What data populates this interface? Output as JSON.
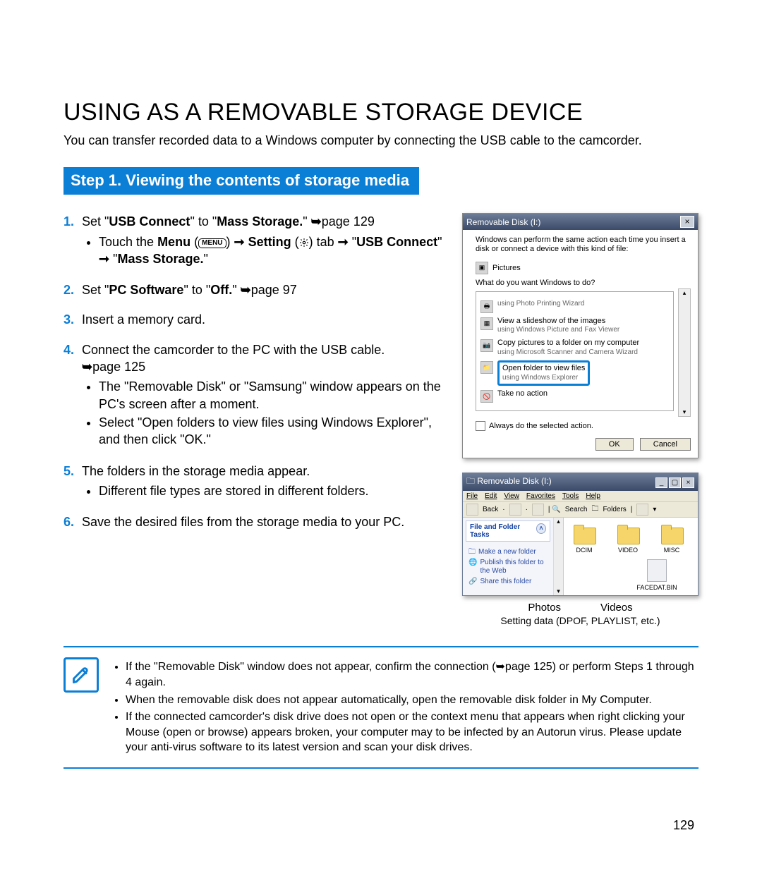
{
  "title": "USING AS A REMOVABLE STORAGE DEVICE",
  "intro": "You can transfer recorded data to a Windows computer by connecting the USB cable to the camcorder.",
  "step_heading": "Step 1. Viewing the contents of storage media",
  "arrow": "➞",
  "parrow": "➥",
  "menu_badge": "MENU",
  "li1": {
    "pre": "Set \"",
    "u": "USB Connect",
    "mid": "\" to \"",
    "m": "Mass Storage.",
    "post": "\" ",
    "page": "page 129"
  },
  "li1b": {
    "pre": "Touch the ",
    "menu": "Menu",
    "setting": "Setting",
    "tab": " tab ",
    "usb": "USB Connect",
    "ms": "Mass Storage."
  },
  "li2": {
    "pre": "Set \"",
    "pc": "PC Software",
    "mid": "\" to \"",
    "off": "Off.",
    "post": "\" ",
    "page": "page 97"
  },
  "li3": "Insert a memory card.",
  "li4": {
    "t": "Connect the camcorder to the PC with the USB cable.",
    "page": "page 125",
    "b1": "The \"Removable Disk\" or \"Samsung\" window appears on the PC's screen after a moment.",
    "b2": "Select \"Open folders to view files using Windows Explorer\", and then click \"OK.\""
  },
  "li5": {
    "t": "The folders in the storage media appear.",
    "b1": "Different file types are stored in different folders."
  },
  "li6": "Save the desired files from the storage media to your PC.",
  "dialog": {
    "title": "Removable Disk (I:)",
    "msg": "Windows can perform the same action each time you insert a disk or connect a device with this kind of file:",
    "pictures": "Pictures",
    "q": "What do you want Windows to do?",
    "opt1a": "using Photo Printing Wizard",
    "opt2a": "View a slideshow of the images",
    "opt2b": "using Windows Picture and Fax Viewer",
    "opt3a": "Copy pictures to a folder on my computer",
    "opt3b": "using Microsoft Scanner and Camera Wizard",
    "opt4a": "Open folder to view files",
    "opt4b": "using Windows Explorer",
    "opt5": "Take no action",
    "always": "Always do the selected action.",
    "ok": "OK",
    "cancel": "Cancel"
  },
  "explorer": {
    "title": "Removable Disk (I:)",
    "menu": {
      "file": "File",
      "edit": "Edit",
      "view": "View",
      "fav": "Favorites",
      "tools": "Tools",
      "help": "Help"
    },
    "back": "Back",
    "search": "Search",
    "folders": "Folders",
    "panel": "File and Folder Tasks",
    "task1": "Make a new folder",
    "task2": "Publish this folder to the Web",
    "task3": "Share this folder",
    "f1": "DCIM",
    "f2": "VIDEO",
    "f3": "MISC",
    "bin": "FACEDAT.BIN"
  },
  "caption": {
    "photos": "Photos",
    "videos": "Videos",
    "setting": "Setting data (DPOF, PLAYLIST, etc.)"
  },
  "notes": [
    "If the \"Removable Disk\" window does not appear, confirm the connection (➥page 125) or perform Steps 1 through 4 again.",
    "When the removable disk does not appear automatically, open the removable disk folder in My Computer.",
    "If the connected camcorder's disk drive does not open or the context menu that appears when right clicking your Mouse (open or browse) appears broken, your computer may to be infected by an Autorun virus. Please update your anti-virus software to its latest version and scan your disk drives."
  ],
  "pagenum": "129"
}
